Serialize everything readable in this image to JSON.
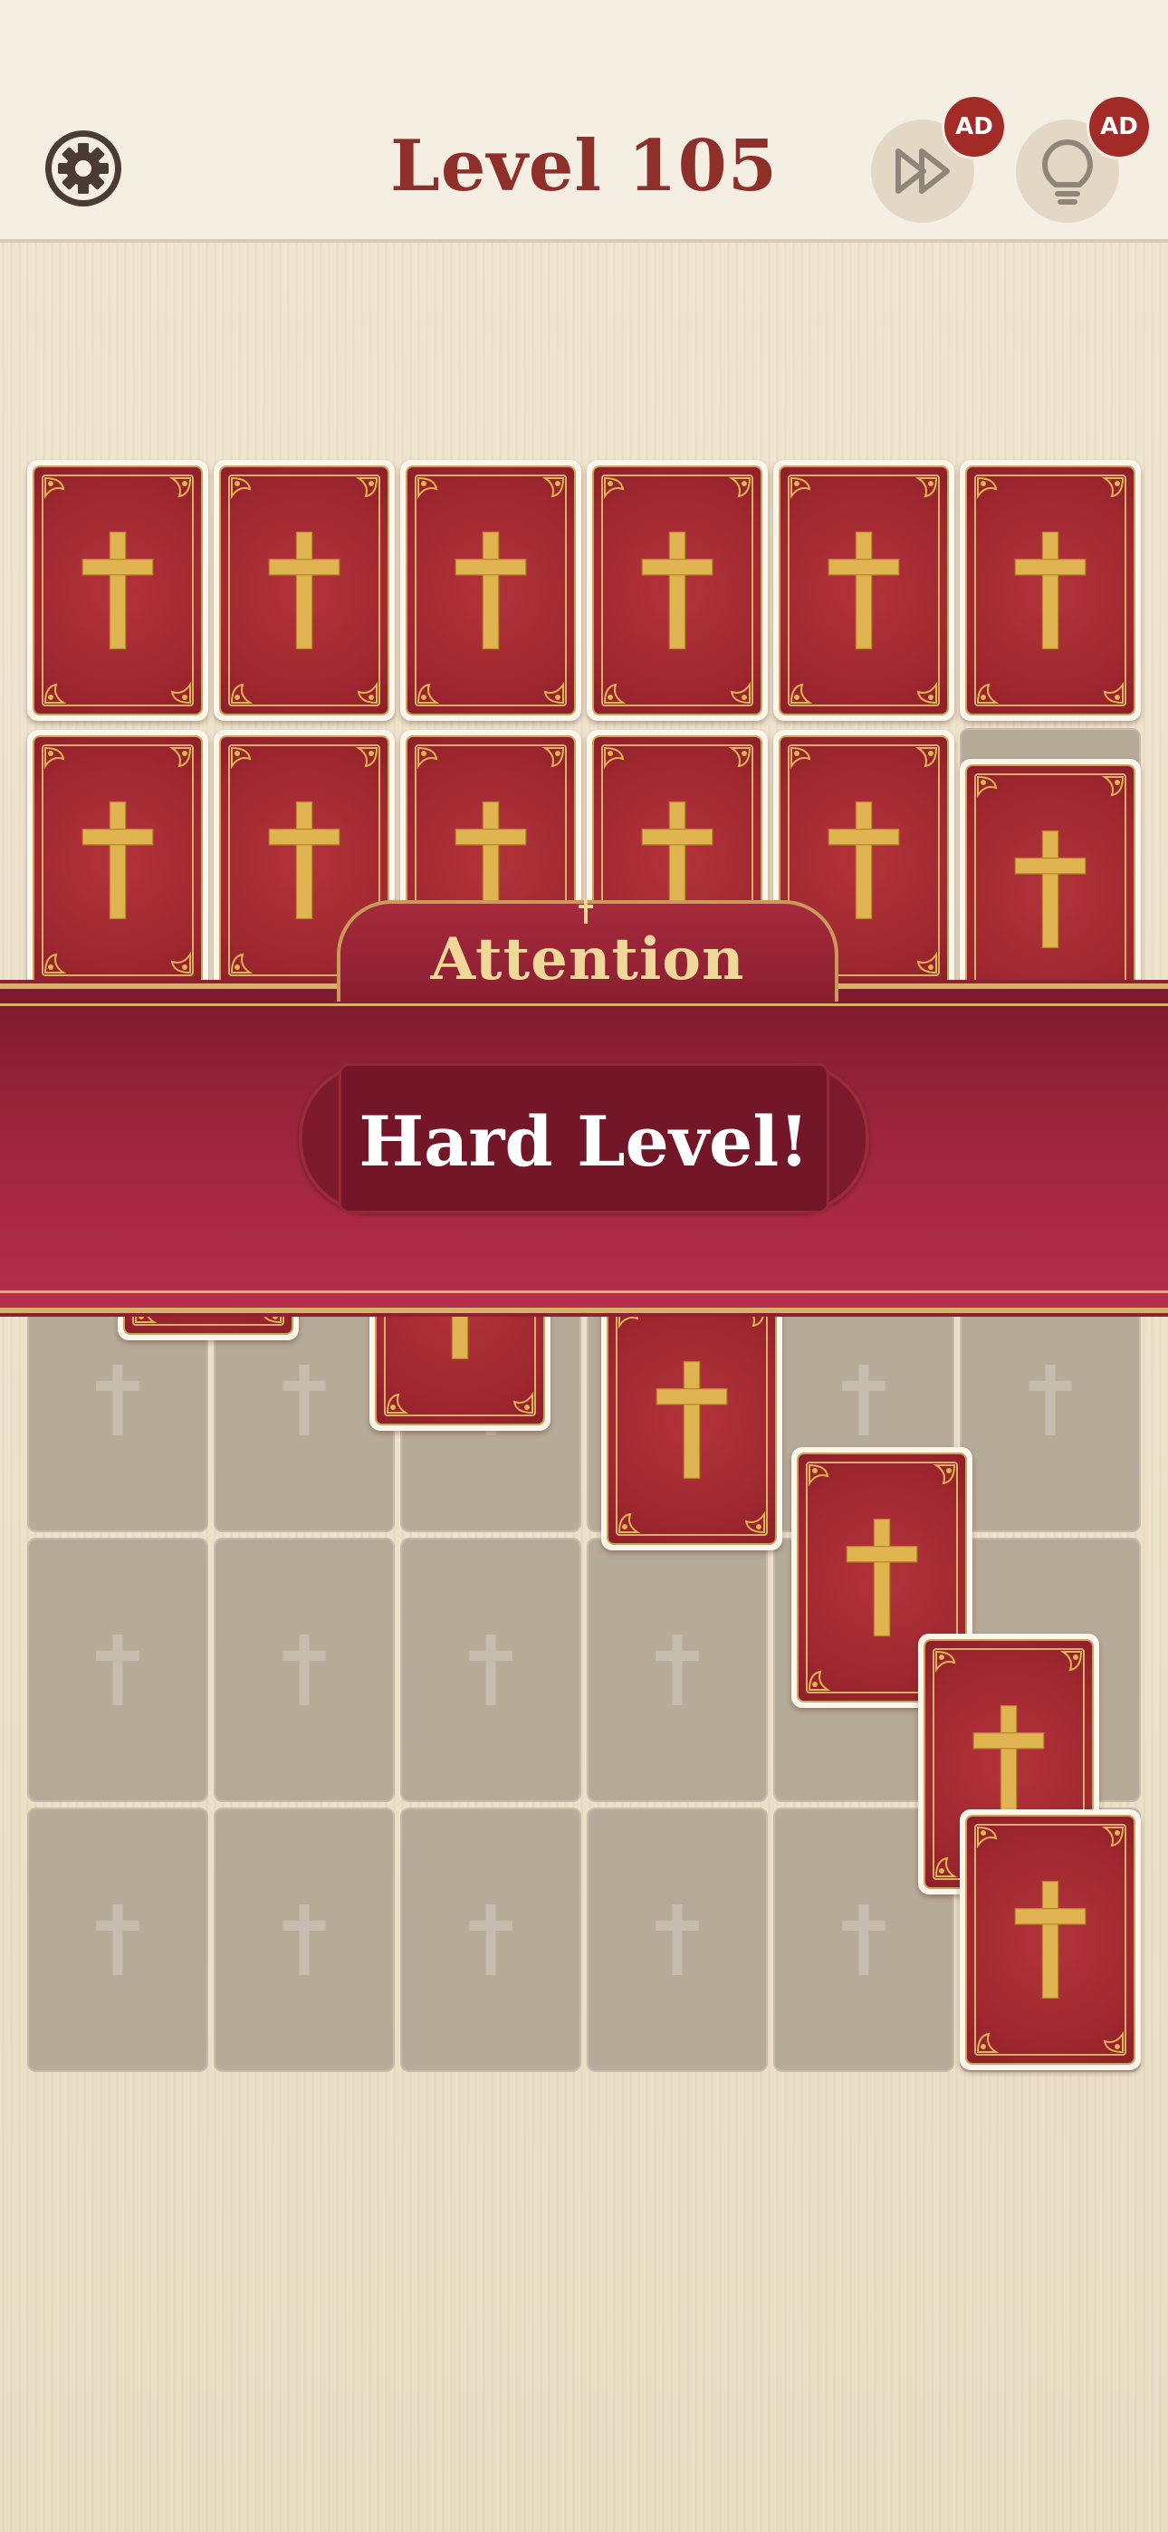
{
  "header": {
    "title": "Level 105",
    "skip_badge": "AD",
    "hint_badge": "AD"
  },
  "icons": {
    "settings": "gear-icon",
    "skip": "fast-forward-icon",
    "hint": "lightbulb-icon",
    "card_symbol": "cross-icon"
  },
  "banner": {
    "tab_label": "Attention",
    "message": "Hard Level!"
  },
  "colors": {
    "card_red": "#a32b33",
    "gold": "#e0b451",
    "banner": "#9b2339",
    "title": "#8e2f2a"
  }
}
